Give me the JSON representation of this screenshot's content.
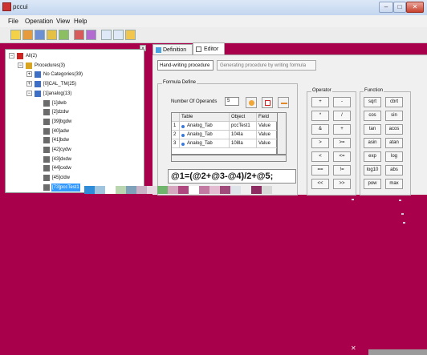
{
  "window": {
    "title": "pccui"
  },
  "menu": [
    "File",
    "Operation",
    "View",
    "Help"
  ],
  "tree": [
    {
      "label": "All(2)",
      "indent": 0,
      "exp": "−",
      "icon": "#cc2222"
    },
    {
      "label": "Procedures(3)",
      "indent": 1,
      "exp": "−",
      "icon": "#d9a520"
    },
    {
      "label": "No Categories(39)",
      "indent": 2,
      "exp": "+",
      "icon": "#3d6fc7"
    },
    {
      "label": "[0]CAL_TM(25)",
      "indent": 2,
      "exp": "+",
      "icon": "#3d6fc7"
    },
    {
      "label": "[1]analog(13)",
      "indent": 2,
      "exp": "−",
      "icon": "#3d6fc7"
    },
    {
      "label": "[1]dwb",
      "indent": 3,
      "exp": "",
      "icon": "#6b6b6b"
    },
    {
      "label": "[2]dzdw",
      "indent": 3,
      "exp": "",
      "icon": "#6b6b6b"
    },
    {
      "label": "[39]bgdw",
      "indent": 3,
      "exp": "",
      "icon": "#6b6b6b"
    },
    {
      "label": "[40]adw",
      "indent": 3,
      "exp": "",
      "icon": "#6b6b6b"
    },
    {
      "label": "[41]bdw",
      "indent": 3,
      "exp": "",
      "icon": "#6b6b6b"
    },
    {
      "label": "[42]cydw",
      "indent": 3,
      "exp": "",
      "icon": "#6b6b6b"
    },
    {
      "label": "[43]dxdw",
      "indent": 3,
      "exp": "",
      "icon": "#6b6b6b"
    },
    {
      "label": "[44]cxdw",
      "indent": 3,
      "exp": "",
      "icon": "#6b6b6b"
    },
    {
      "label": "[45]cldw",
      "indent": 3,
      "exp": "",
      "icon": "#6b6b6b"
    },
    {
      "label": "[73]pccTest1",
      "indent": 3,
      "exp": "",
      "icon": "#6b6b6b",
      "selected": true
    }
  ],
  "tabs": {
    "definition": "Definition",
    "editor": "Editor"
  },
  "handwriting_button": "Hand-writing procedure",
  "generating_field": "Generating procedure by writing formula",
  "formula_define": {
    "legend": "Formula Define",
    "operands_label": "Number Of Operands",
    "operands_value": "5",
    "table": {
      "headers": [
        "",
        "Table",
        "Object",
        "Field"
      ],
      "rows": [
        [
          "1",
          "Analog_Tab",
          "pccTest1",
          "Value"
        ],
        [
          "2",
          "Analog_Tab",
          "104la",
          "Value"
        ],
        [
          "3",
          "Analog_Tab",
          "108la",
          "Value"
        ]
      ]
    },
    "formula": "@1=(@2+@3-@4)/2+@5;"
  },
  "operator": {
    "legend": "Operator",
    "buttons": [
      "+",
      "-",
      "*",
      "/",
      "&",
      "+",
      ">",
      ">=",
      "<",
      "<=",
      "==",
      "!=",
      "<<",
      ">>"
    ]
  },
  "function": {
    "legend": "Function",
    "buttons": [
      "sqrt",
      "cbrt",
      "cos",
      "sin",
      "tan",
      "acos",
      "asin",
      "atan",
      "exp",
      "log",
      "log10",
      "abs",
      "pow",
      "max"
    ]
  },
  "colors": {
    "background": "#a8004a",
    "selection": "#3399ff"
  },
  "icons": {
    "definition_tab": "definition-icon",
    "editor_tab": "editor-icon",
    "operand_actions": [
      "settings-icon",
      "clear-icon",
      "minimize-icon"
    ]
  }
}
